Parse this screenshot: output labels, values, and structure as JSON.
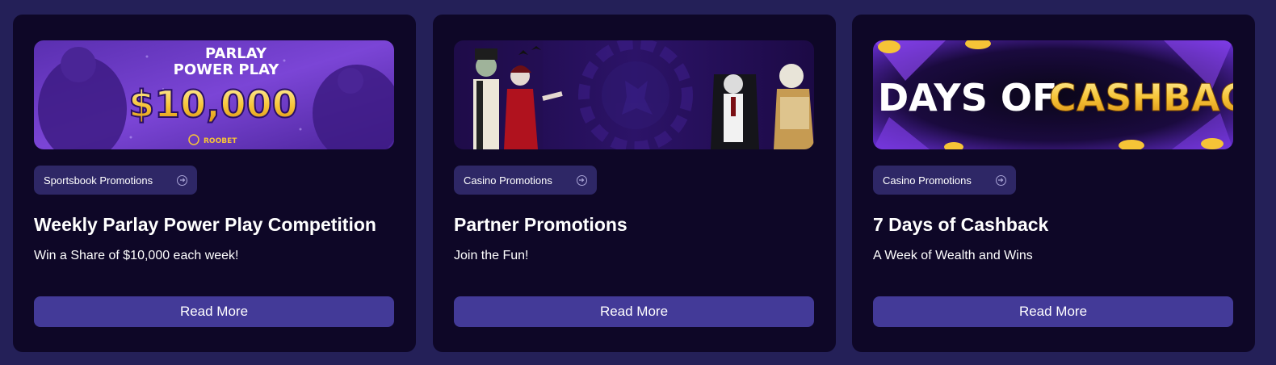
{
  "cards": [
    {
      "category": "Sportsbook Promotions",
      "title": "Weekly Parlay Power Play Competition",
      "subtitle": "Win a Share of $10,000 each week!",
      "button": "Read More",
      "banner": {
        "line1": "PARLAY",
        "line2": "POWER PLAY",
        "amount": "$10,000",
        "brand": "ROOBET"
      }
    },
    {
      "category": "Casino Promotions",
      "title": "Partner Promotions",
      "subtitle": "Join the Fun!",
      "button": "Read More"
    },
    {
      "category": "Casino Promotions",
      "title": "7 Days of Cashback",
      "subtitle": "A Week of Wealth and Wins",
      "button": "Read More",
      "banner": {
        "word1": "DAYS OF",
        "word2": "CASHBAC"
      }
    }
  ],
  "icons": {
    "chip_icon": "arrow-right-circle-icon"
  },
  "colors": {
    "page_bg": "#242058",
    "card_bg": "#0e0727",
    "chip_bg": "#2e2766",
    "button_bg": "#433a98",
    "gold": "#f6c437"
  }
}
